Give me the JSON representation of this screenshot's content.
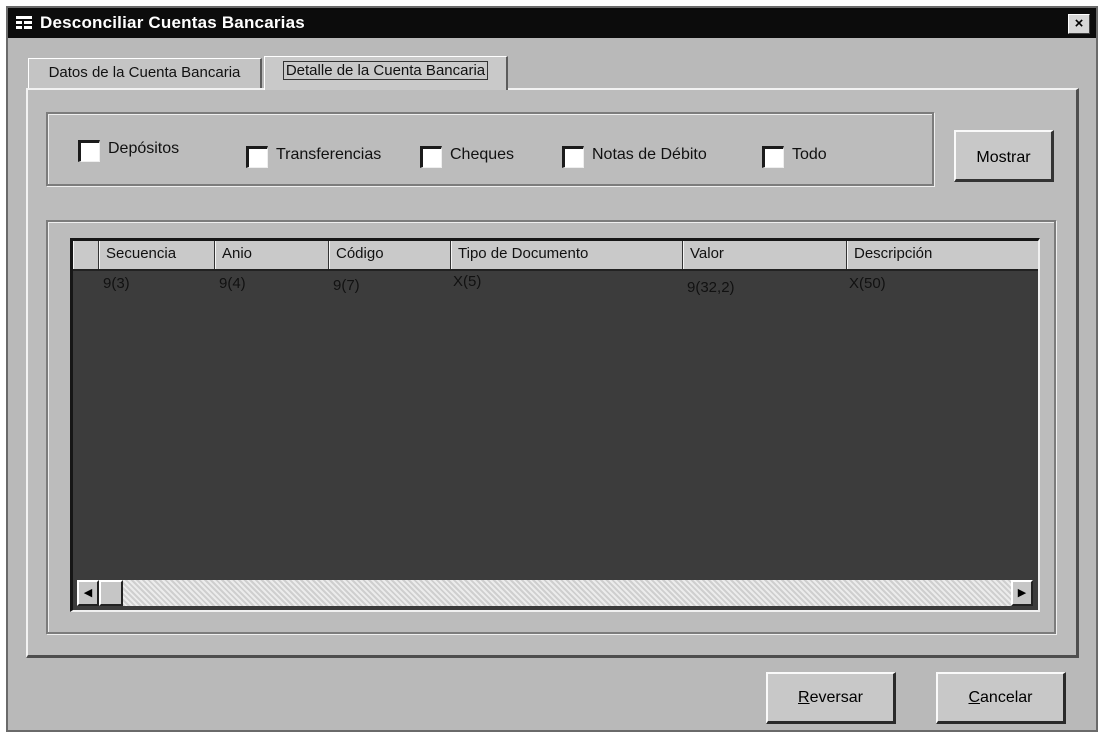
{
  "window": {
    "title": "Desconciliar Cuentas Bancarias",
    "close_glyph": "×",
    "app_icon": "table-icon"
  },
  "tabs": [
    {
      "label": "Datos de la Cuenta Bancaria",
      "active": false
    },
    {
      "label": "Detalle de la Cuenta Bancaria",
      "active": true
    }
  ],
  "filters": [
    {
      "label": "Depósitos",
      "checked": false
    },
    {
      "label": "Transferencias",
      "checked": false
    },
    {
      "label": "Cheques",
      "checked": false
    },
    {
      "label": "Notas de Débito",
      "checked": false
    },
    {
      "label": "Todo",
      "checked": false
    }
  ],
  "mostrar_label": "Mostrar",
  "grid": {
    "columns": [
      "Secuencia",
      "Anio",
      "Código",
      "Tipo de Documento",
      "Valor",
      "Descripción"
    ],
    "rows": [
      [
        "9(3)",
        "9(4)",
        "9(7)",
        "X(5)",
        "9(32,2)",
        "X(50)"
      ]
    ]
  },
  "scroll": {
    "left_glyph": "◀",
    "right_glyph": "▶"
  },
  "buttons": {
    "reversar": {
      "mnemonic": "R",
      "rest": "eversar"
    },
    "cancelar": {
      "mnemonic": "C",
      "rest": "ancelar"
    }
  }
}
